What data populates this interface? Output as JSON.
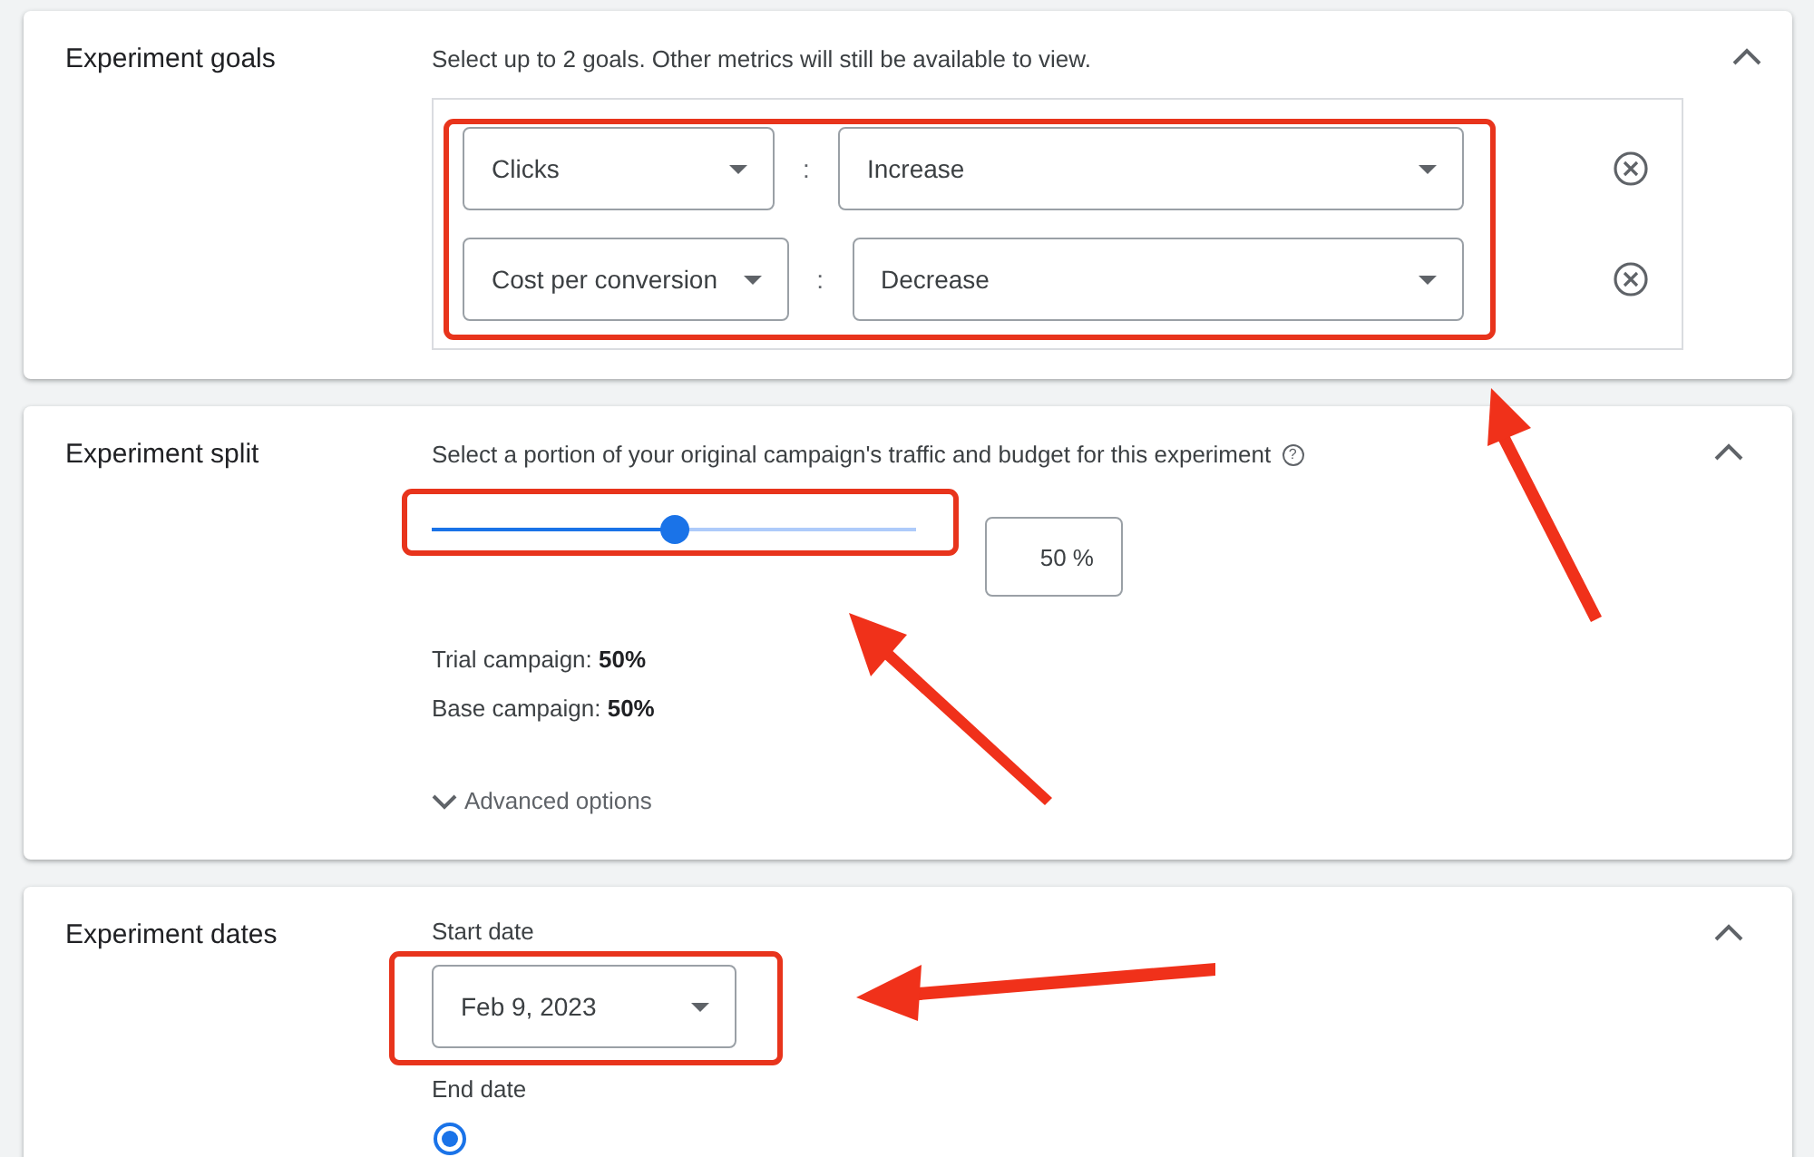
{
  "sections": [
    {
      "kind": "goals",
      "title": "Experiment goals",
      "expanded": true,
      "description": "Select up to 2 goals. Other metrics will still be available to view.",
      "goals": [
        {
          "metric": "Clicks",
          "separator": ":",
          "direction": "Increase"
        },
        {
          "metric": "Cost per conversion",
          "separator": ":",
          "direction": "Decrease"
        }
      ]
    },
    {
      "kind": "split",
      "title": "Experiment split",
      "expanded": true,
      "description": "Select a portion of your original campaign's traffic and budget for this experiment",
      "help_icon": "?",
      "slider": {
        "level": 0.5
      },
      "percent_field": {
        "value": "50 %"
      },
      "summary": [
        "Trial campaign: **50%**",
        "Base campaign: **50%**"
      ],
      "advanced_link": "Advanced options"
    },
    {
      "kind": "dates",
      "title": "Experiment dates",
      "expanded": true,
      "start_label": "Start date",
      "start_date": "Feb 9, 2023",
      "end_label": "End date",
      "end_options": [
        {
          "selected": true
        }
      ]
    }
  ]
}
